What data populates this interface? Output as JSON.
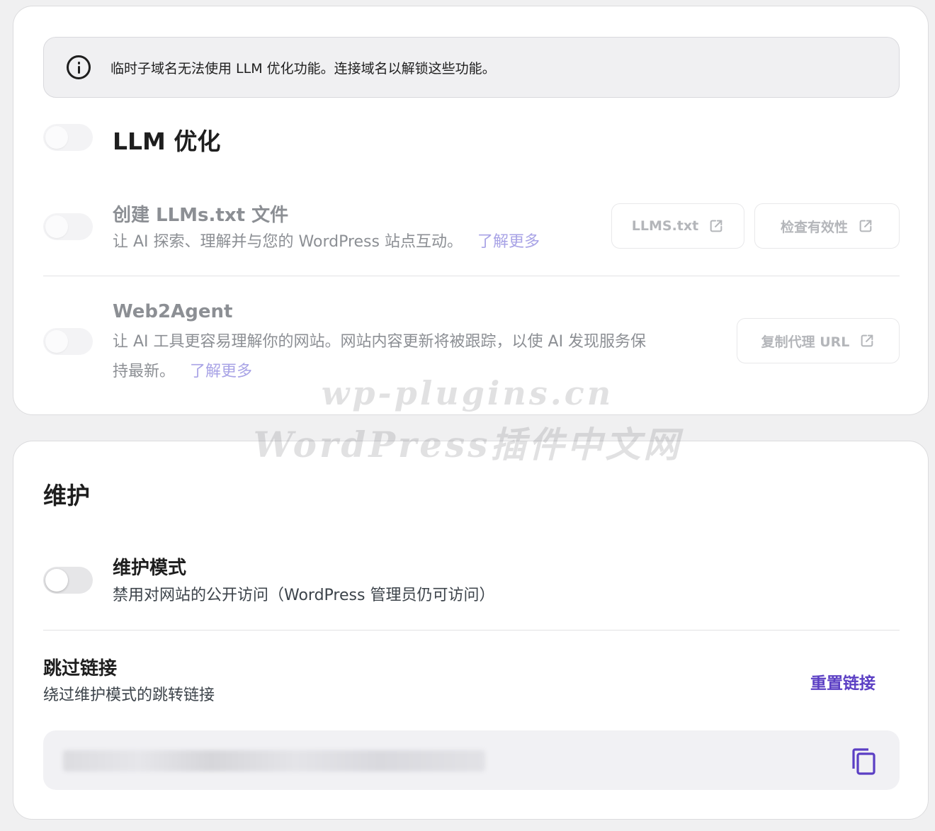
{
  "notice": {
    "text": "临时子域名无法使用 LLM 优化功能。连接域名以解锁这些功能。"
  },
  "llm": {
    "title": "LLM 优化",
    "llms_txt": {
      "title": "创建 LLMs.txt 文件",
      "desc": "让 AI 探索、理解并与您的 WordPress 站点互动。",
      "learn_more": "了解更多",
      "btn_file": "LLMS.txt",
      "btn_check": "检查有效性"
    },
    "web2agent": {
      "title": "Web2Agent",
      "desc_line1": "让 AI 工具更容易理解你的网站。网站内容更新将被跟踪，以使 AI 发现服务保",
      "desc_line2": "持最新。",
      "learn_more": "了解更多",
      "btn_copy": "复制代理 URL"
    }
  },
  "maintenance": {
    "title": "维护",
    "mode": {
      "title": "维护模式",
      "desc": "禁用对网站的公开访问（WordPress 管理员仍可访问）"
    },
    "bypass": {
      "title": "跳过链接",
      "desc": "绕过维护模式的跳转链接",
      "reset": "重置链接"
    }
  },
  "watermark": {
    "line1": "wp-plugins.cn",
    "line2": "WordPress插件中文网"
  },
  "colors": {
    "accent": "#5b3fc4",
    "learn_more_faded": "#a8a3e6",
    "muted_text": "#8c8f94"
  }
}
